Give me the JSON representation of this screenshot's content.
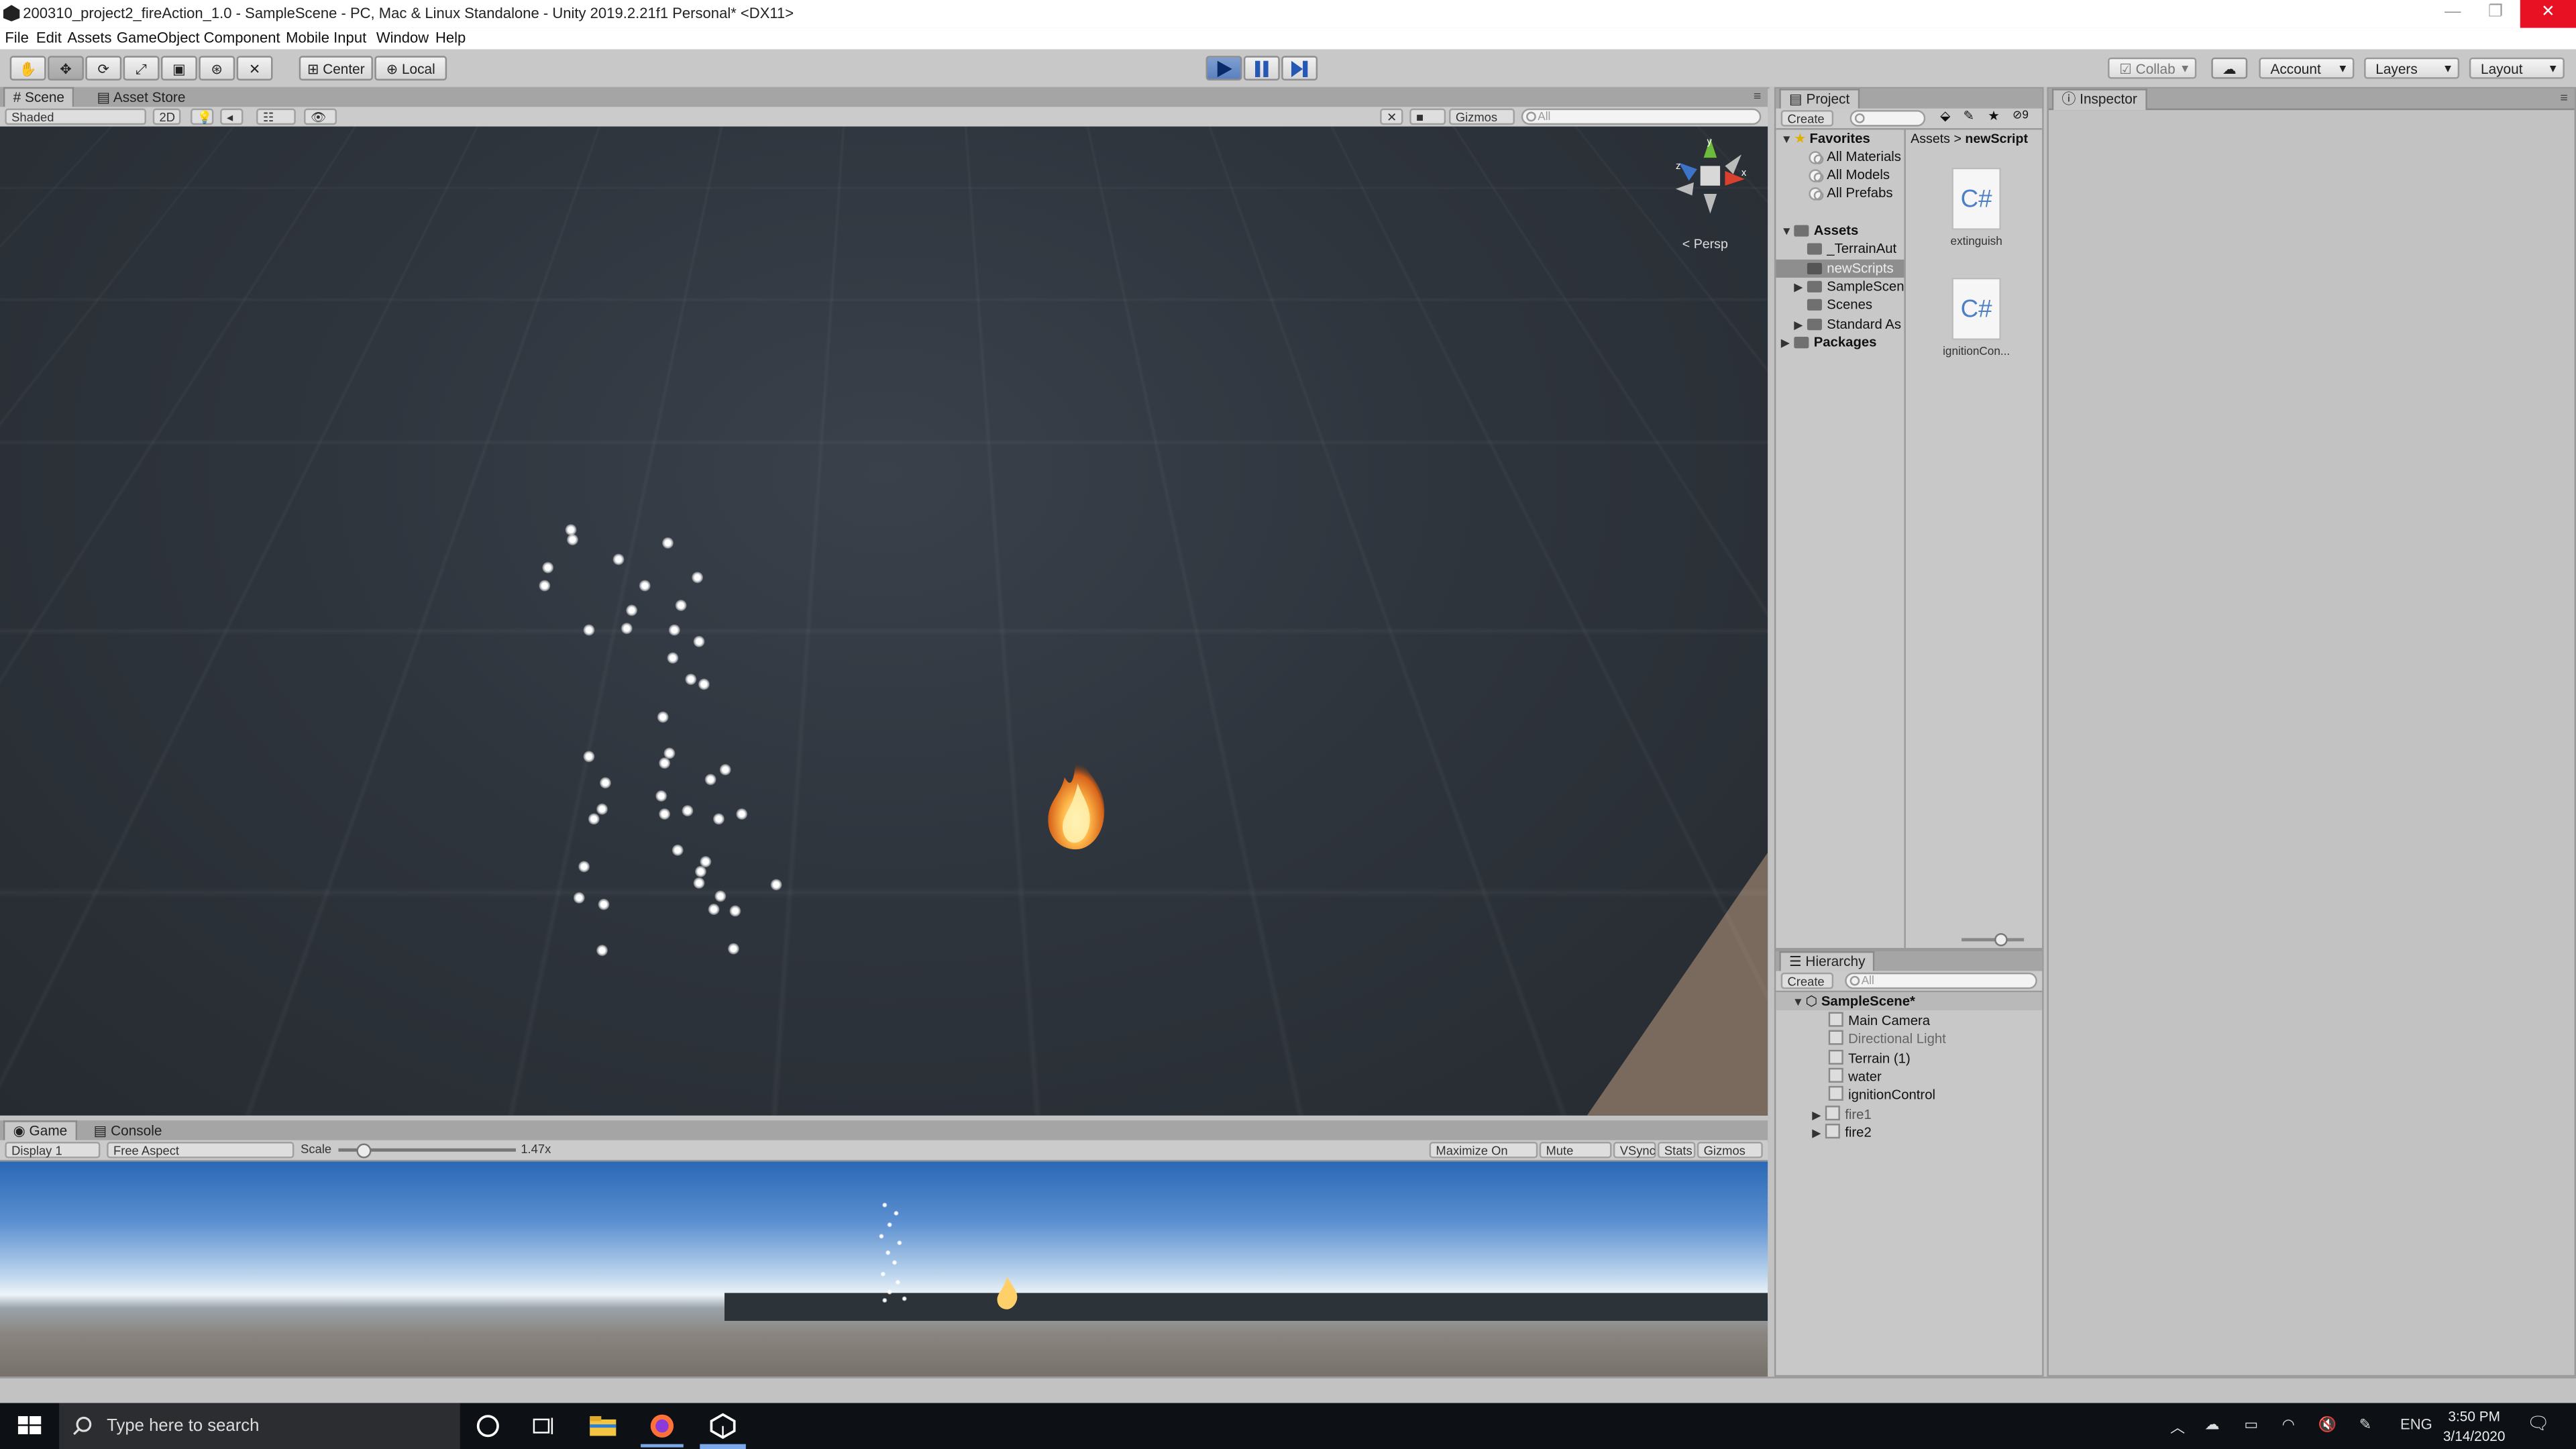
{
  "window": {
    "title": "200310_project2_fireAction_1.0 - SampleScene - PC, Mac & Linux Standalone - Unity 2019.2.21f1 Personal* <DX11>",
    "minimize": "—",
    "maximize": "❐",
    "close": "✕"
  },
  "menu": [
    "File",
    "Edit",
    "Assets",
    "GameObject",
    "Component",
    "Mobile Input",
    "Window",
    "Help"
  ],
  "toolbar": {
    "tools": [
      "hand-tool",
      "move-tool",
      "rotate-tool",
      "scale-tool",
      "rect-tool",
      "transform-tool",
      "custom-tool"
    ],
    "pivot_label": "Center",
    "space_label": "Local",
    "play_state": "playing",
    "collab_label": "Collab",
    "account_label": "Account",
    "layers_label": "Layers",
    "layout_label": "Layout"
  },
  "scene": {
    "tabs": [
      "Scene",
      "Asset Store"
    ],
    "shading_mode": "Shaded",
    "mode_2d": "2D",
    "hidden_count": "0",
    "gizmos_label": "Gizmos",
    "search_placeholder": "All",
    "persp_label": "Persp",
    "gizmo_axes": {
      "x": "x",
      "y": "y",
      "z": "z"
    }
  },
  "game": {
    "tabs": [
      "Game",
      "Console"
    ],
    "display": "Display 1",
    "aspect": "Free Aspect",
    "scale_label": "Scale",
    "scale_value": "1.47x",
    "scale_fraction": 0.13,
    "options": [
      "Maximize On Play",
      "Mute Audio",
      "VSync",
      "Stats",
      "Gizmos"
    ]
  },
  "project": {
    "tab": "Project",
    "create_label": "Create",
    "hidden_count": "9",
    "favorites": {
      "label": "Favorites",
      "items": [
        "All Materials",
        "All Models",
        "All Prefabs"
      ]
    },
    "assets": {
      "label": "Assets",
      "items": [
        "_TerrainAut",
        "newScripts",
        "SampleScen",
        "Scenes",
        "Standard As"
      ]
    },
    "packages_label": "Packages",
    "breadcrumb": [
      "Assets",
      "newScript"
    ],
    "files": [
      {
        "icon": "C#",
        "name": "extinguish"
      },
      {
        "icon": "C#",
        "name": "ignitionCon..."
      }
    ]
  },
  "hierarchy": {
    "tab": "Hierarchy",
    "create_label": "Create",
    "search_placeholder": "All",
    "scene": "SampleScene*",
    "items": [
      "Main Camera",
      "Directional Light",
      "Terrain (1)",
      "water",
      "ignitionControl",
      "fire1",
      "fire2"
    ]
  },
  "inspector": {
    "tab": "Inspector"
  },
  "taskbar": {
    "search_placeholder": "Type here to search",
    "language": "ENG",
    "time": "3:50 PM",
    "date": "3/14/2020"
  },
  "colors": {
    "editor_bg": "#c2c2c2",
    "play_active": "#5b80c0",
    "scene_bg": "#2f353d",
    "taskbar": "#0d1015",
    "close_red": "#e81123"
  }
}
